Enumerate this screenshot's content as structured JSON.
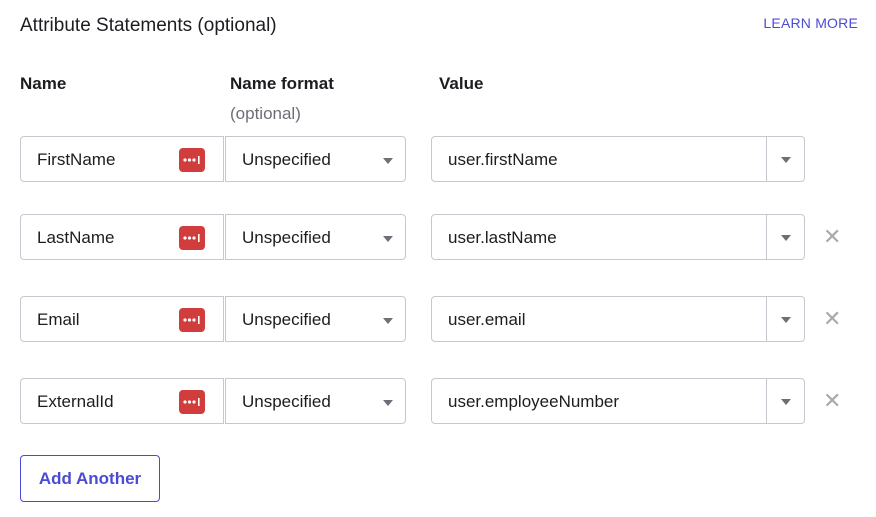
{
  "section": {
    "title": "Attribute Statements (optional)",
    "learn_more": "LEARN MORE"
  },
  "columns": {
    "name": "Name",
    "name_format": "Name format",
    "name_format_sub": "(optional)",
    "value": "Value"
  },
  "rows": [
    {
      "name": "FirstName",
      "format": "Unspecified",
      "value": "user.firstName",
      "removable": false
    },
    {
      "name": "LastName",
      "format": "Unspecified",
      "value": "user.lastName",
      "removable": true
    },
    {
      "name": "Email",
      "format": "Unspecified",
      "value": "user.email",
      "removable": true
    },
    {
      "name": "ExternalId",
      "format": "Unspecified",
      "value": "user.employeeNumber",
      "removable": true
    }
  ],
  "icons": {
    "password_manager": "password-manager-icon",
    "dropdown": "chevron-down-icon",
    "remove": "close-icon",
    "remove_glyph": "✕"
  },
  "colors": {
    "accent": "#4b4bd6",
    "password_icon": "#d13c3c",
    "border": "#c7c7cf"
  },
  "add_button": "Add Another"
}
